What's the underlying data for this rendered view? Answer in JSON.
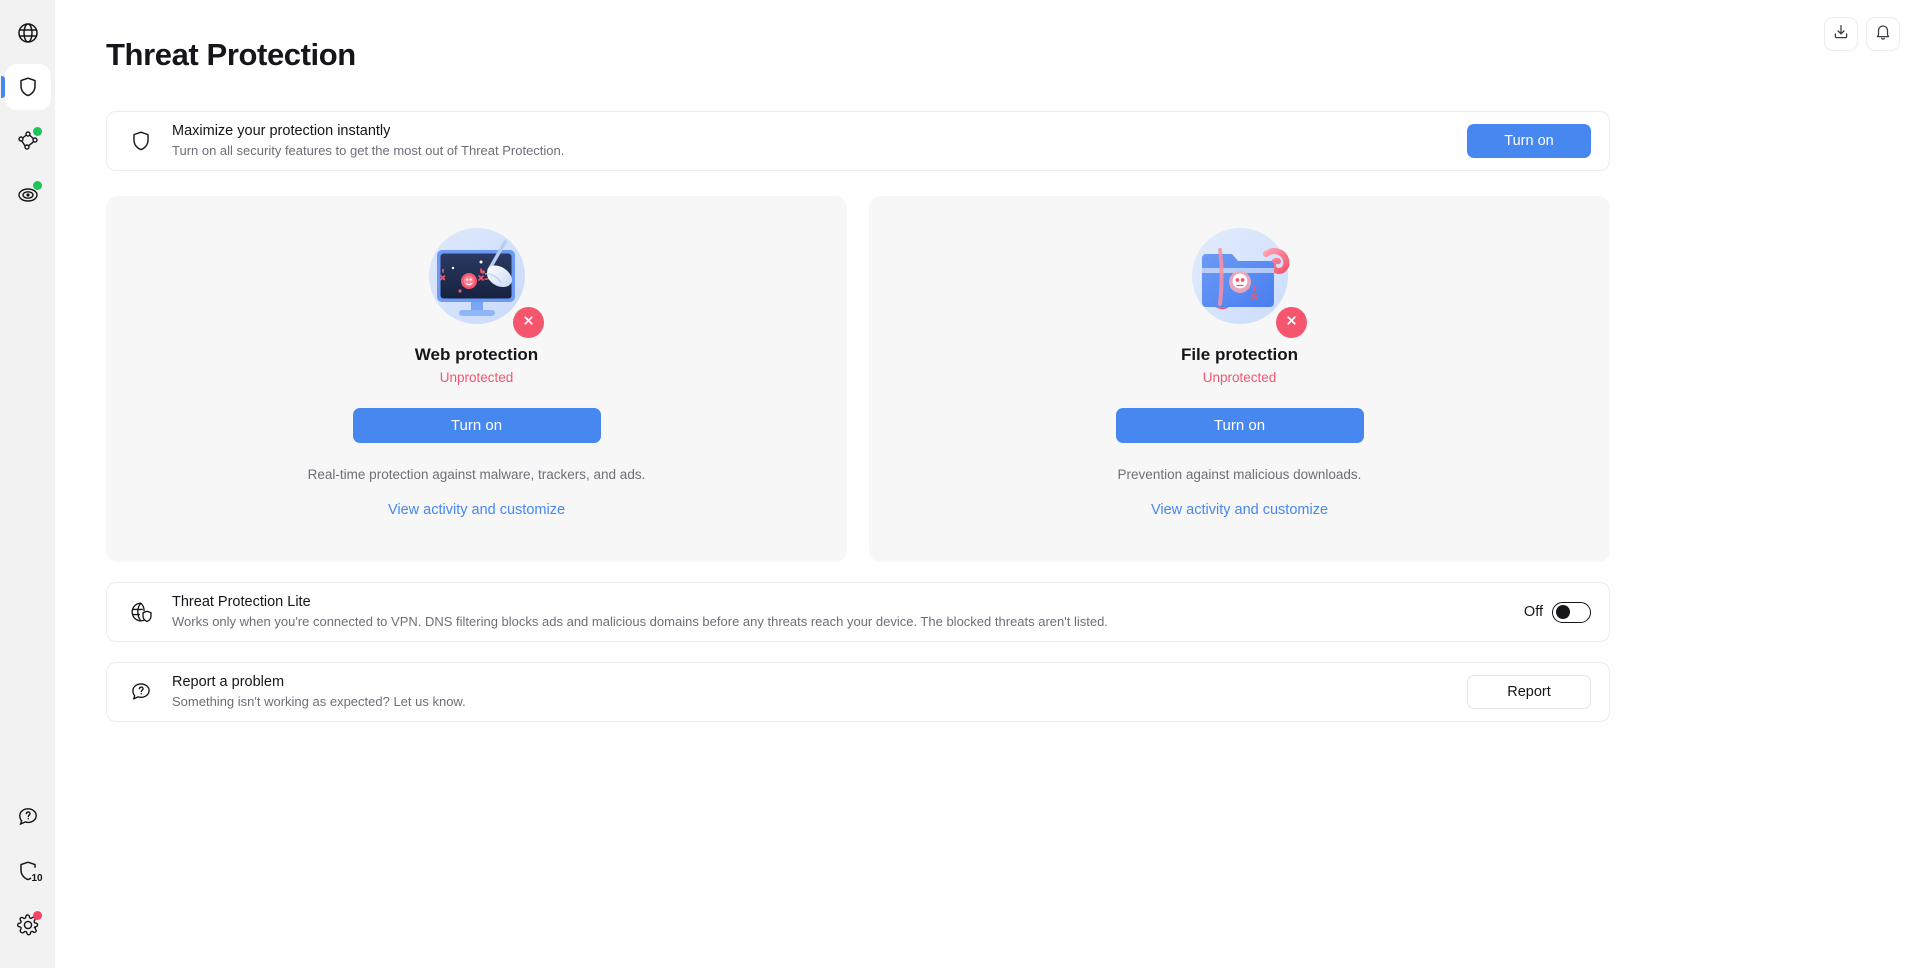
{
  "sidebar": {
    "top_items": [
      {
        "name": "vpn",
        "icon": "globe-icon",
        "active": false,
        "badge": null
      },
      {
        "name": "threat-protection",
        "icon": "shield-icon",
        "active": true,
        "badge": null
      },
      {
        "name": "meshnet",
        "icon": "meshnet-icon",
        "active": false,
        "badge": "green-dot"
      },
      {
        "name": "dark-web-monitor",
        "icon": "radar-icon",
        "active": false,
        "badge": "green-dot"
      }
    ],
    "bottom_items": [
      {
        "name": "help",
        "icon": "help-bubble-icon",
        "badge": null,
        "count": null
      },
      {
        "name": "shield-score",
        "icon": "shield-count-icon",
        "badge": null,
        "count": "10"
      },
      {
        "name": "settings",
        "icon": "gear-icon",
        "badge": "red-dot",
        "count": null
      }
    ]
  },
  "topbar": {
    "download_icon": "download-icon",
    "notifications_icon": "bell-icon"
  },
  "header": {
    "title": "Threat Protection"
  },
  "banner": {
    "icon": "shield-icon",
    "title": "Maximize your protection instantly",
    "subtitle": "Turn on all security features to get the most out of Threat Protection.",
    "button_label": "Turn on"
  },
  "cards": [
    {
      "illustration": "monitor-broom-illustration",
      "badge_icon": "close-x-icon",
      "title": "Web protection",
      "status": "Unprotected",
      "button_label": "Turn on",
      "description": "Real-time protection against malware, trackers, and ads.",
      "link_label": "View activity and customize"
    },
    {
      "illustration": "infected-folder-illustration",
      "badge_icon": "close-x-icon",
      "title": "File protection",
      "status": "Unprotected",
      "button_label": "Turn on",
      "description": "Prevention against malicious downloads.",
      "link_label": "View activity and customize"
    }
  ],
  "lite_row": {
    "icon": "globe-shield-icon",
    "title": "Threat Protection Lite",
    "subtitle": "Works only when you're connected to VPN. DNS filtering blocks ads and malicious domains before any threats reach your device. The blocked threats aren't listed.",
    "toggle_label": "Off",
    "toggle_state": "off"
  },
  "report_row": {
    "icon": "question-bubble-icon",
    "title": "Report a problem",
    "subtitle": "Something isn't working as expected? Let us know.",
    "button_label": "Report"
  },
  "colors": {
    "accent_blue": "#4687f0",
    "danger_red": "#f5566e",
    "online_green": "#20c45a",
    "sidebar_bg": "#f2f2f3",
    "card_bg": "#f7f7f8",
    "text_primary": "#16161a",
    "text_secondary": "#6e6e78"
  }
}
